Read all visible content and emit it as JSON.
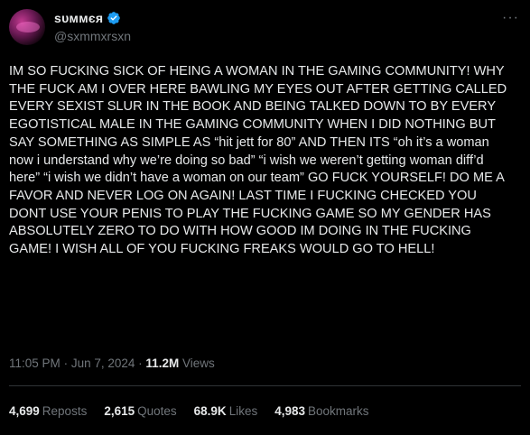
{
  "author": {
    "display_name": "sυммєя",
    "handle": "@sxmmxrsxn",
    "verified": true
  },
  "tweet": {
    "text": "IM SO FUCKING SICK OF HEING A WOMAN IN THE GAMING COMMUNITY! WHY THE FUCK AM I OVER HERE BAWLING MY EYES OUT AFTER GETTING CALLED EVERY SEXIST SLUR IN THE BOOK AND BEING TALKED DOWN TO BY EVERY EGOTISTICAL MALE IN THE GAMING COMMUNITY WHEN I DID NOTHING BUT SAY SOMETHING AS SIMPLE AS “hit jett for 80” AND THEN ITS “oh it’s a woman now i understand why we’re doing so bad” “i wish we weren’t getting woman diff’d here” “i wish we didn’t have a woman on our team” GO FUCK YOURSELF! DO ME A FAVOR AND NEVER LOG ON AGAIN! LAST TIME I FUCKING CHECKED YOU DONT USE YOUR PENIS TO PLAY THE FUCKING GAME SO MY GENDER HAS ABSOLUTELY ZERO TO DO WITH HOW GOOD IM DOING IN THE FUCKING GAME! I WISH ALL OF YOU FUCKING FREAKS WOULD GO TO HELL!",
    "time": "11:05 PM",
    "date": "Jun 7, 2024",
    "separator": "·",
    "views_count": "11.2M",
    "views_label": "Views"
  },
  "stats": {
    "reposts": {
      "count": "4,699",
      "label": "Reposts"
    },
    "quotes": {
      "count": "2,615",
      "label": "Quotes"
    },
    "likes": {
      "count": "68.9K",
      "label": "Likes"
    },
    "bookmarks": {
      "count": "4,983",
      "label": "Bookmarks"
    }
  },
  "icons": {
    "more": "more-options-icon",
    "verified": "verified-badge-icon"
  },
  "colors": {
    "background": "#000000",
    "text": "#e7e9ea",
    "secondary": "#71767b",
    "verified": "#1d9bf0",
    "divider": "#2f3336"
  }
}
